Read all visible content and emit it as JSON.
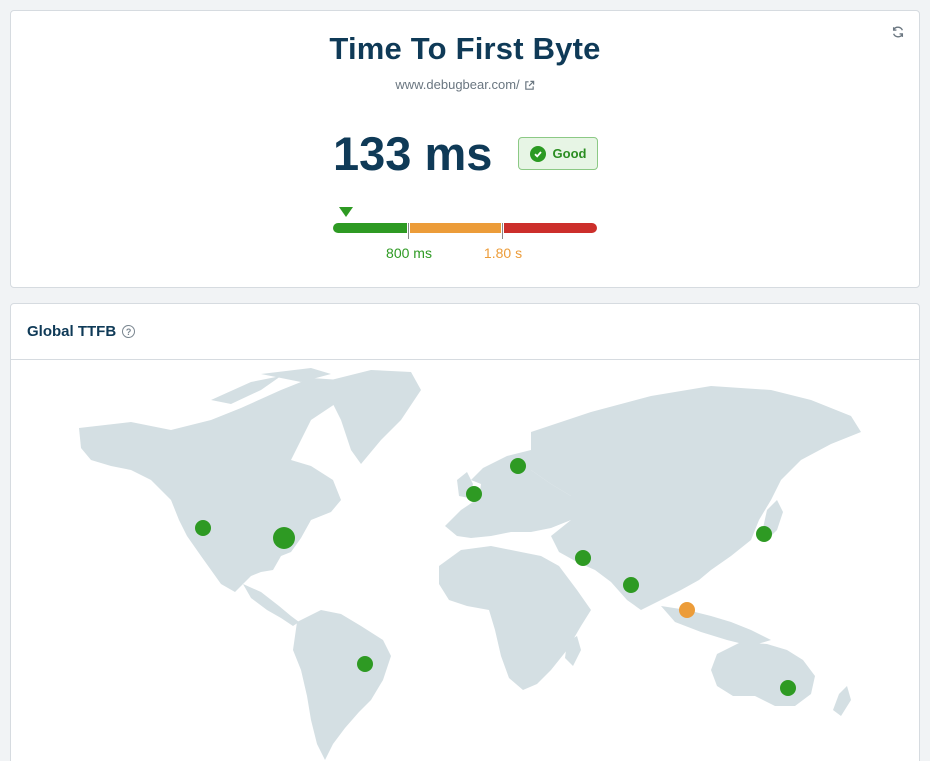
{
  "summary": {
    "title": "Time To First Byte",
    "url": "www.debugbear.com/",
    "value": "133 ms",
    "rating": "Good",
    "thresholds": [
      "800 ms",
      "1.80 s"
    ],
    "progress_fraction": 0.0,
    "colors": {
      "good": "#2e9a23",
      "needs_improvement": "#ec9c39",
      "poor": "#cc2f2b"
    },
    "icons": {
      "refresh": "refresh-icon",
      "external": "external-link-icon",
      "check": "check-circle-icon"
    }
  },
  "map_section": {
    "title": "Global TTFB",
    "help_icon": "help-icon",
    "locations": [
      {
        "name": "us-west",
        "rating": "good",
        "color": "#2e9a23"
      },
      {
        "name": "us-east",
        "rating": "good",
        "color": "#2e9a23",
        "highlighted": true
      },
      {
        "name": "brazil",
        "rating": "good",
        "color": "#2e9a23"
      },
      {
        "name": "uk",
        "rating": "good",
        "color": "#2e9a23"
      },
      {
        "name": "scandinavia",
        "rating": "good",
        "color": "#2e9a23"
      },
      {
        "name": "middle-east",
        "rating": "good",
        "color": "#2e9a23"
      },
      {
        "name": "india",
        "rating": "good",
        "color": "#2e9a23"
      },
      {
        "name": "singapore",
        "rating": "needs-improvement",
        "color": "#ec9c39"
      },
      {
        "name": "japan",
        "rating": "good",
        "color": "#2e9a23"
      },
      {
        "name": "australia",
        "rating": "good",
        "color": "#2e9a23"
      }
    ]
  }
}
